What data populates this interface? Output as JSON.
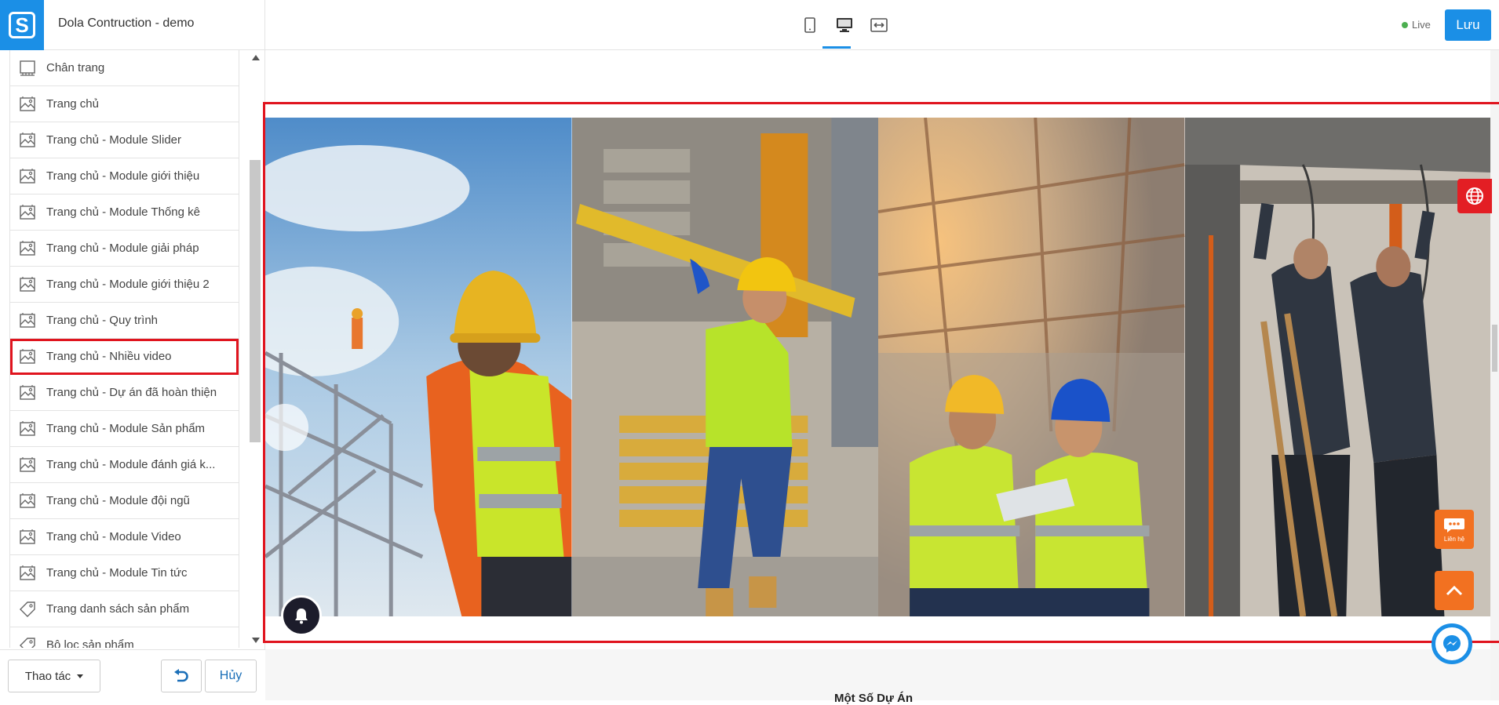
{
  "app": {
    "site_title": "Dola Contruction - demo",
    "live_label": "Live",
    "save_label": "Lưu",
    "colors": {
      "accent": "#1b8fe6",
      "highlight": "#e0141e",
      "orange": "#f27121"
    }
  },
  "toolbar": {
    "devices": [
      {
        "name": "mobile-view",
        "icon": "mobile-icon"
      },
      {
        "name": "desktop-view",
        "icon": "desktop-icon",
        "selected": true
      },
      {
        "name": "fullwidth-view",
        "icon": "fullwidth-icon"
      }
    ]
  },
  "sidebar": {
    "items": [
      {
        "label": "Chân trang",
        "icon": "layout-icon"
      },
      {
        "label": "Trang chủ",
        "icon": "image-icon"
      },
      {
        "label": "Trang chủ - Module Slider",
        "icon": "image-icon"
      },
      {
        "label": "Trang chủ - Module giới thiệu",
        "icon": "image-icon"
      },
      {
        "label": "Trang chủ - Module Thống kê",
        "icon": "image-icon"
      },
      {
        "label": "Trang chủ - Module giải pháp",
        "icon": "image-icon"
      },
      {
        "label": "Trang chủ - Module giới thiệu 2",
        "icon": "image-icon"
      },
      {
        "label": "Trang chủ - Quy trình",
        "icon": "image-icon"
      },
      {
        "label": "Trang chủ - Nhiều video",
        "icon": "image-icon",
        "active": true
      },
      {
        "label": "Trang chủ - Dự án đã hoàn thiện",
        "icon": "image-icon"
      },
      {
        "label": "Trang chủ - Module Sản phẩm",
        "icon": "image-icon"
      },
      {
        "label": "Trang chủ - Module đánh giá k...",
        "icon": "image-icon"
      },
      {
        "label": "Trang chủ - Module đội ngũ",
        "icon": "image-icon"
      },
      {
        "label": "Trang chủ - Module Video",
        "icon": "image-icon"
      },
      {
        "label": "Trang chủ - Module Tin tức",
        "icon": "image-icon"
      },
      {
        "label": "Trang danh sách sản phẩm",
        "icon": "tag-icon"
      },
      {
        "label": "Bộ lọc sản phẩm",
        "icon": "tag-icon"
      }
    ],
    "actions_label": "Thao tác",
    "cancel_label": "Hủy"
  },
  "canvas": {
    "gallery": [
      {
        "name": "worker-scaffold-photo"
      },
      {
        "name": "worker-carrying-beam-photo"
      },
      {
        "name": "engineers-tablet-photo"
      },
      {
        "name": "workers-ceiling-photo"
      }
    ],
    "next_section_title": "Một Số Dự Án",
    "contact_label": "Liên hệ"
  }
}
